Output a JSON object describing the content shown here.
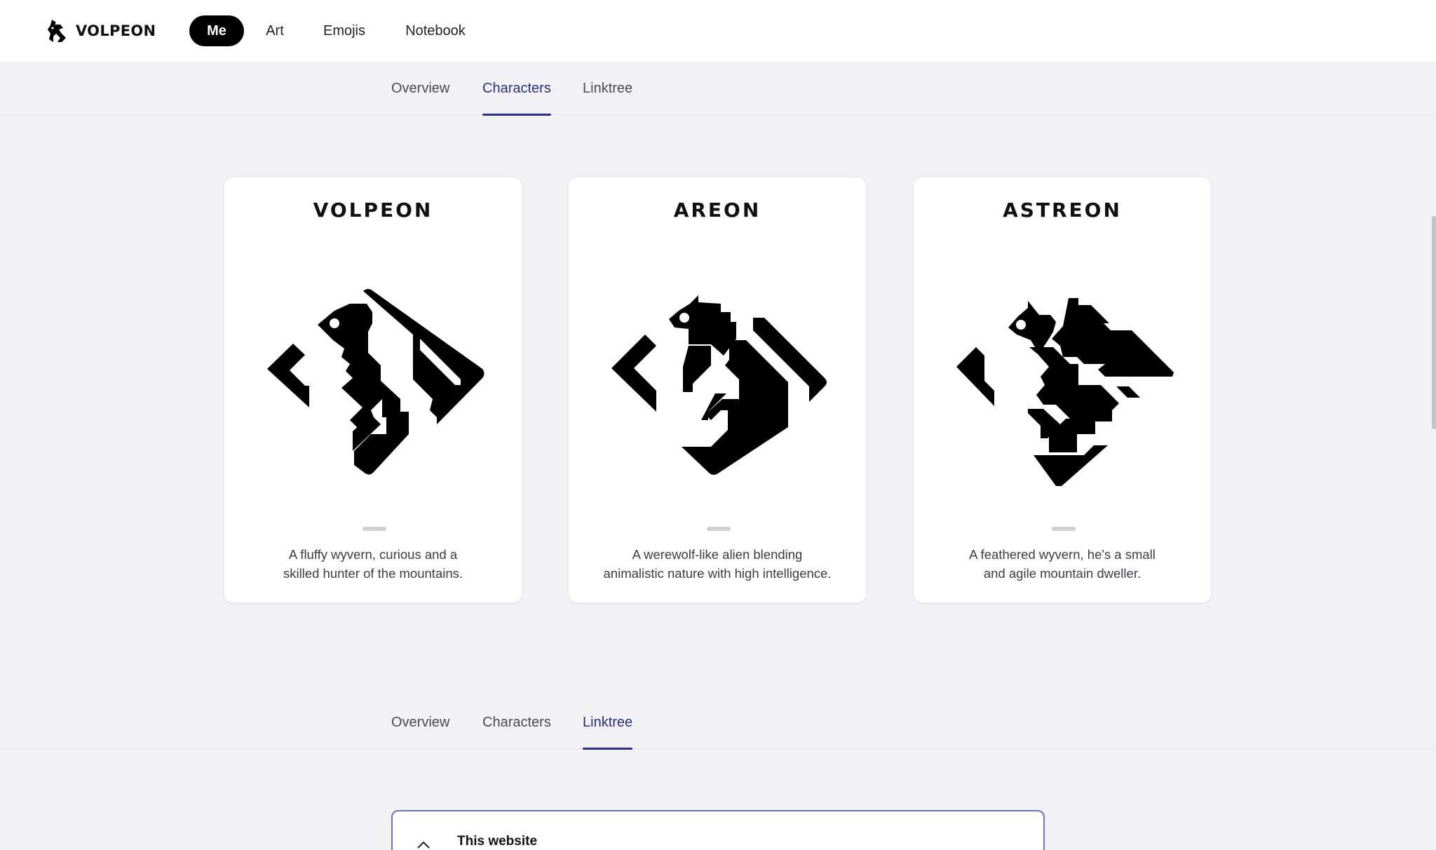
{
  "brand": {
    "name": "VOLPEON",
    "icon": "wyvern-logo-icon"
  },
  "nav": {
    "items": [
      "Me",
      "Art",
      "Emojis",
      "Notebook"
    ],
    "active": "Me"
  },
  "tabs_top": {
    "items": [
      "Overview",
      "Characters",
      "Linktree"
    ],
    "active": "Characters"
  },
  "characters": [
    {
      "name": "VOLPEON",
      "description_line1": "A fluffy wyvern, curious and a",
      "description_line2": "skilled hunter of the mountains.",
      "icon": "volpeon-character-icon"
    },
    {
      "name": "AREON",
      "description_line1": "A werewolf-like alien blending",
      "description_line2": "animalistic nature with high intelligence.",
      "icon": "areon-character-icon"
    },
    {
      "name": "ASTREON",
      "description_line1": "A feathered wyvern, he's a small",
      "description_line2": "and agile mountain dweller.",
      "icon": "astreon-character-icon"
    }
  ],
  "tabs_bottom": {
    "items": [
      "Overview",
      "Characters",
      "Linktree"
    ],
    "active": "Linktree"
  },
  "linktree": {
    "first_item_title": "This website",
    "first_item_icon": "chevron-up-icon"
  },
  "colors": {
    "accent": "#2a2f86",
    "page_bg": "#f2f2f4",
    "card_bg": "#ffffff",
    "link_border": "#6b74c8"
  }
}
